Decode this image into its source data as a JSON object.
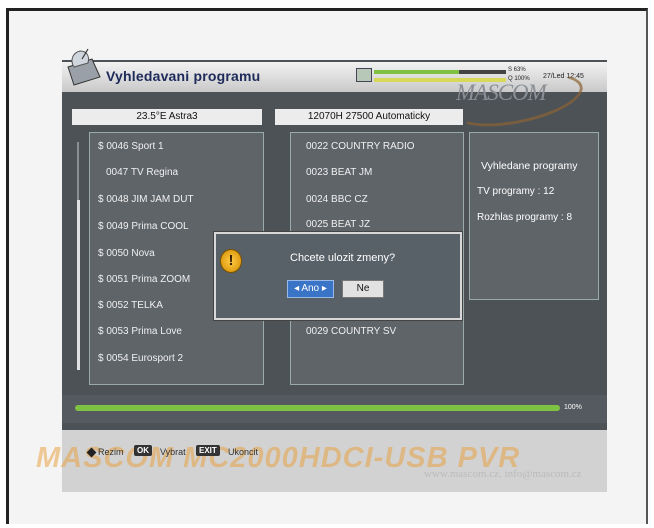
{
  "header": {
    "title": "Vyhledavani programu",
    "signal_strength": "S 63%",
    "signal_quality": "Q 100%",
    "date_time": "27/Led 12:45",
    "brand_logo": "MASCOM"
  },
  "satellite": {
    "name": "23.5°E Astra3",
    "transponder": "12070H 27500 Automaticky"
  },
  "tv_list": [
    "$ 0046 Sport 1",
    "0047 TV Regina",
    "$ 0048 JIM JAM DUT",
    "$ 0049 Prima COOL",
    "$ 0050 Nova",
    "$ 0051 Prima ZOOM",
    "$ 0052 TELKA",
    "$ 0053 Prima Love",
    "$ 0054 Eurosport 2"
  ],
  "radio_list": [
    "0022 COUNTRY RADIO",
    "0023 BEAT JM",
    "0024 BBC CZ",
    "0025 BEAT JZ",
    "0029 COUNTRY SV"
  ],
  "summary": {
    "title": "Vyhledane programy",
    "tv_label": "TV programy : 12",
    "radio_label": "Rozhlas programy : 8"
  },
  "dialog": {
    "question": "Chcete ulozit zmeny?",
    "yes": "◂ Ano ▸",
    "no": "Ne",
    "icon": "warning-icon"
  },
  "progress": {
    "percent_text": "100%",
    "fill_fraction": 1.0
  },
  "footer": {
    "rezim": "Rezim",
    "ok_key": "OK",
    "vybrat": "Vybrat",
    "exit_key": "EXIT",
    "ukoncit": "Ukoncit"
  },
  "watermark": {
    "model": "MASCOM MC2000HDCI-USB PVR",
    "web": "www.mascom.cz, info@mascom.cz"
  },
  "colors": {
    "accent_green": "#7fc142",
    "selected_button": "#3a74c7",
    "panel": "#5f6469"
  }
}
